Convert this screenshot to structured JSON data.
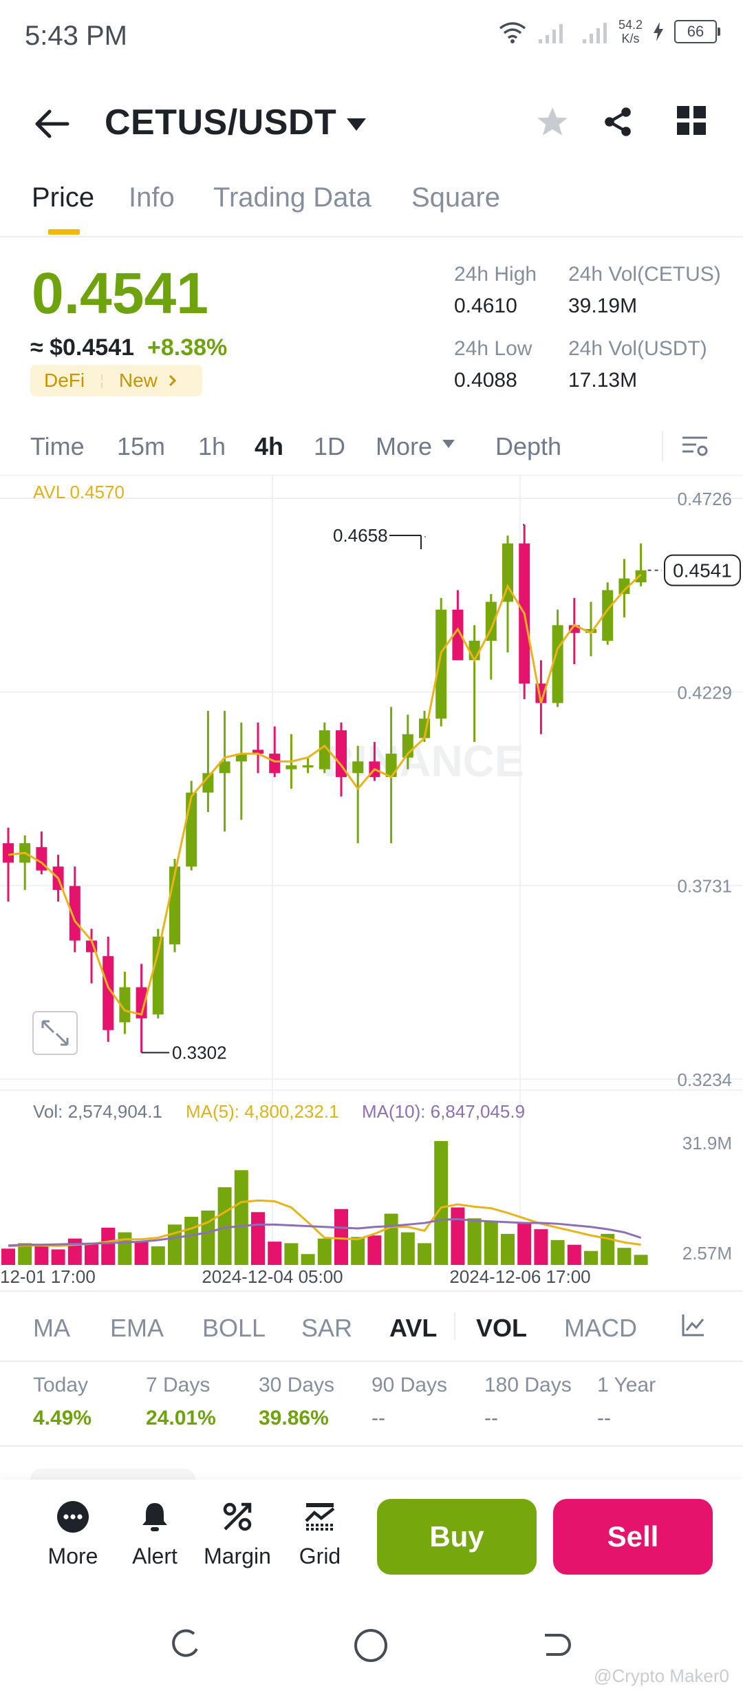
{
  "status_bar": {
    "time": "5:43 PM",
    "net_speed_value": "54.2",
    "net_speed_unit": "K/s",
    "battery": "66"
  },
  "header": {
    "pair": "CETUS/USDT"
  },
  "tabs": [
    "Price",
    "Info",
    "Trading Data",
    "Square"
  ],
  "price": {
    "last": "0.4541",
    "fiat": "≈ $0.4541",
    "change": "+8.38%",
    "tag_category": "DeFi",
    "tag_new": "New",
    "high_label": "24h High",
    "high": "0.4610",
    "low_label": "24h Low",
    "low": "0.4088",
    "vol_base_label": "24h Vol(CETUS)",
    "vol_base": "39.19M",
    "vol_quote_label": "24h Vol(USDT)",
    "vol_quote": "17.13M"
  },
  "timeframes": [
    "Time",
    "15m",
    "1h",
    "4h",
    "1D",
    "More",
    "Depth"
  ],
  "timeframe_active": "4h",
  "chart_labels": {
    "avl": "AVL 0.4570",
    "max_marker": "0.4658",
    "min_marker": "0.3302",
    "current_price": "0.4541",
    "y_ticks": [
      "0.4726",
      "0.4229",
      "0.3731",
      "0.3234"
    ],
    "vol": "Vol: 2,574,904.1",
    "ma5": "MA(5): 4,800,232.1",
    "ma10": "MA(10): 6,847,045.9",
    "vol_ticks": [
      "31.9M",
      "2.57M"
    ],
    "x_ticks": [
      "12-01 17:00",
      "2024-12-04 05:00",
      "2024-12-06 17:00"
    ]
  },
  "chart_data": {
    "type": "candlestick",
    "price_range": [
      0.3234,
      0.4726
    ],
    "volume_range": [
      0,
      31.9
    ],
    "candles": [
      {
        "o": 0.384,
        "h": 0.388,
        "l": 0.369,
        "c": 0.379,
        "v": 4.2
      },
      {
        "o": 0.379,
        "h": 0.386,
        "l": 0.372,
        "c": 0.384,
        "v": 5.6
      },
      {
        "o": 0.383,
        "h": 0.387,
        "l": 0.376,
        "c": 0.377,
        "v": 5.2
      },
      {
        "o": 0.378,
        "h": 0.381,
        "l": 0.369,
        "c": 0.372,
        "v": 4.0
      },
      {
        "o": 0.373,
        "h": 0.378,
        "l": 0.356,
        "c": 0.359,
        "v": 6.8
      },
      {
        "o": 0.359,
        "h": 0.362,
        "l": 0.348,
        "c": 0.356,
        "v": 5.6
      },
      {
        "o": 0.355,
        "h": 0.36,
        "l": 0.333,
        "c": 0.336,
        "v": 9.6
      },
      {
        "o": 0.338,
        "h": 0.351,
        "l": 0.335,
        "c": 0.347,
        "v": 8.4
      },
      {
        "o": 0.347,
        "h": 0.353,
        "l": 0.3302,
        "c": 0.339,
        "v": 6.0
      },
      {
        "o": 0.34,
        "h": 0.362,
        "l": 0.339,
        "c": 0.36,
        "v": 4.8
      },
      {
        "o": 0.358,
        "h": 0.38,
        "l": 0.356,
        "c": 0.378,
        "v": 10.4
      },
      {
        "o": 0.378,
        "h": 0.4,
        "l": 0.377,
        "c": 0.397,
        "v": 12.4
      },
      {
        "o": 0.397,
        "h": 0.418,
        "l": 0.392,
        "c": 0.402,
        "v": 14.0
      },
      {
        "o": 0.402,
        "h": 0.418,
        "l": 0.387,
        "c": 0.405,
        "v": 20.0
      },
      {
        "o": 0.405,
        "h": 0.415,
        "l": 0.39,
        "c": 0.407,
        "v": 24.4
      },
      {
        "o": 0.408,
        "h": 0.415,
        "l": 0.402,
        "c": 0.407,
        "v": 13.6
      },
      {
        "o": 0.407,
        "h": 0.414,
        "l": 0.401,
        "c": 0.402,
        "v": 6.0
      },
      {
        "o": 0.403,
        "h": 0.412,
        "l": 0.398,
        "c": 0.404,
        "v": 5.6
      },
      {
        "o": 0.404,
        "h": 0.406,
        "l": 0.402,
        "c": 0.404,
        "v": 2.8
      },
      {
        "o": 0.403,
        "h": 0.415,
        "l": 0.402,
        "c": 0.413,
        "v": 6.8
      },
      {
        "o": 0.413,
        "h": 0.415,
        "l": 0.396,
        "c": 0.401,
        "v": 14.4
      },
      {
        "o": 0.402,
        "h": 0.409,
        "l": 0.384,
        "c": 0.405,
        "v": 7.2
      },
      {
        "o": 0.405,
        "h": 0.41,
        "l": 0.4,
        "c": 0.401,
        "v": 7.6
      },
      {
        "o": 0.401,
        "h": 0.419,
        "l": 0.384,
        "c": 0.407,
        "v": 13.2
      },
      {
        "o": 0.406,
        "h": 0.417,
        "l": 0.403,
        "c": 0.412,
        "v": 8.4
      },
      {
        "o": 0.411,
        "h": 0.418,
        "l": 0.41,
        "c": 0.416,
        "v": 5.6
      },
      {
        "o": 0.416,
        "h": 0.447,
        "l": 0.414,
        "c": 0.444,
        "v": 31.9
      },
      {
        "o": 0.444,
        "h": 0.449,
        "l": 0.431,
        "c": 0.431,
        "v": 14.8
      },
      {
        "o": 0.431,
        "h": 0.44,
        "l": 0.41,
        "c": 0.436,
        "v": 12.0
      },
      {
        "o": 0.436,
        "h": 0.448,
        "l": 0.426,
        "c": 0.446,
        "v": 11.2
      },
      {
        "o": 0.446,
        "h": 0.463,
        "l": 0.433,
        "c": 0.461,
        "v": 8.0
      },
      {
        "o": 0.461,
        "h": 0.4658,
        "l": 0.421,
        "c": 0.425,
        "v": 10.8
      },
      {
        "o": 0.425,
        "h": 0.431,
        "l": 0.412,
        "c": 0.42,
        "v": 9.2
      },
      {
        "o": 0.42,
        "h": 0.444,
        "l": 0.419,
        "c": 0.44,
        "v": 6.4
      },
      {
        "o": 0.44,
        "h": 0.447,
        "l": 0.43,
        "c": 0.438,
        "v": 5.2
      },
      {
        "o": 0.438,
        "h": 0.446,
        "l": 0.432,
        "c": 0.439,
        "v": 3.6
      },
      {
        "o": 0.436,
        "h": 0.451,
        "l": 0.435,
        "c": 0.449,
        "v": 8.0
      },
      {
        "o": 0.448,
        "h": 0.457,
        "l": 0.442,
        "c": 0.452,
        "v": 4.4
      },
      {
        "o": 0.451,
        "h": 0.461,
        "l": 0.45,
        "c": 0.4541,
        "v": 2.6
      }
    ],
    "avl": [
      0.381,
      0.3815,
      0.379,
      0.375,
      0.364,
      0.359,
      0.347,
      0.341,
      0.34,
      0.356,
      0.376,
      0.396,
      0.401,
      0.406,
      0.407,
      0.407,
      0.405,
      0.405,
      0.406,
      0.409,
      0.404,
      0.398,
      0.403,
      0.401,
      0.407,
      0.411,
      0.433,
      0.439,
      0.431,
      0.439,
      0.45,
      0.443,
      0.42,
      0.434,
      0.44,
      0.438,
      0.444,
      0.449,
      0.453
    ],
    "ma5_vol": [
      4.8,
      5.0,
      5.0,
      4.9,
      5.2,
      5.4,
      6.0,
      6.6,
      6.6,
      7.0,
      8.2,
      9.4,
      11.0,
      13.6,
      16.2,
      16.6,
      16.4,
      14.8,
      11.0,
      7.0,
      6.8,
      6.6,
      8.0,
      9.8,
      9.8,
      8.8,
      14.8,
      15.6,
      15.0,
      14.6,
      13.4,
      12.0,
      10.6,
      9.6,
      8.6,
      7.6,
      6.8,
      5.8,
      5.2
    ],
    "ma10_vol": [
      5.0,
      5.2,
      5.2,
      5.3,
      5.4,
      5.5,
      5.6,
      5.8,
      6.0,
      6.4,
      7.0,
      7.6,
      8.4,
      9.6,
      10.0,
      10.4,
      10.4,
      10.2,
      10.0,
      9.8,
      9.6,
      9.4,
      9.8,
      10.0,
      10.4,
      10.8,
      11.6,
      11.8,
      11.4,
      11.2,
      11.0,
      10.8,
      10.8,
      10.6,
      10.2,
      9.8,
      9.2,
      8.4,
      7.0
    ]
  },
  "indicators": [
    "MA",
    "EMA",
    "BOLL",
    "SAR",
    "AVL",
    "VOL",
    "MACD"
  ],
  "performance": {
    "labels": [
      "Today",
      "7 Days",
      "30 Days",
      "90 Days",
      "180 Days",
      "1 Year"
    ],
    "values": [
      "4.49%",
      "24.01%",
      "39.86%",
      "--",
      "--",
      "--"
    ]
  },
  "bottom": {
    "more": "More",
    "alert": "Alert",
    "margin": "Margin",
    "grid": "Grid",
    "buy": "Buy",
    "sell": "Sell"
  },
  "colors": {
    "up": "#76a70c",
    "down": "#e5136b",
    "avl": "#e8b41c",
    "ma5": "#e8b41c",
    "ma10": "#8e6fb6",
    "accent": "#f0b90b"
  },
  "watermark": "@Crypto Maker0"
}
